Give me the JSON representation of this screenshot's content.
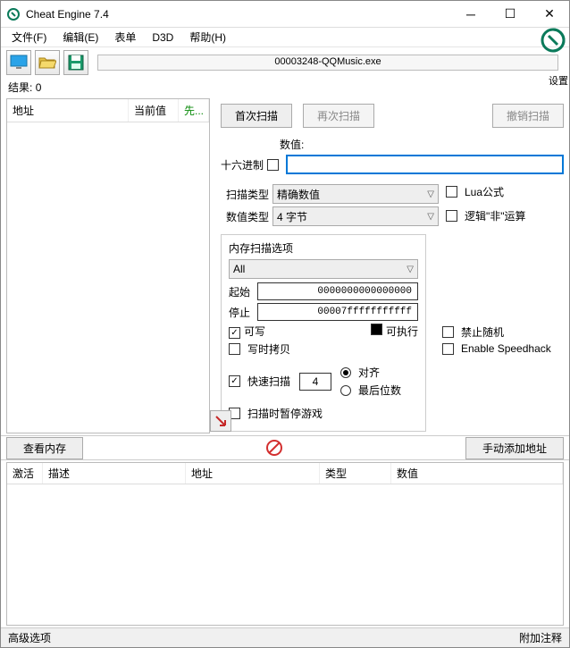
{
  "window": {
    "title": "Cheat Engine 7.4"
  },
  "menu": {
    "file": "文件(F)",
    "edit": "编辑(E)",
    "table": "表单",
    "d3d": "D3D",
    "help": "帮助(H)"
  },
  "toolbar": {
    "process_label": "00003248-QQMusic.exe",
    "settings": "设置"
  },
  "results": {
    "label": "结果:",
    "count": "0"
  },
  "left_headers": {
    "addr": "地址",
    "current": "当前值",
    "prev": "先..."
  },
  "buttons": {
    "first_scan": "首次扫描",
    "next_scan": "再次扫描",
    "undo_scan": "撤销扫描",
    "view_memory": "查看内存",
    "manual_add": "手动添加地址"
  },
  "labels": {
    "value": "数值:",
    "hex": "十六进制",
    "scan_type": "扫描类型",
    "value_type": "数值类型",
    "lua": "Lua公式",
    "not_op": "逻辑\"非\"运算",
    "mem_options": "内存扫描选项",
    "all": "All",
    "start": "起始",
    "stop": "停止",
    "writable": "可写",
    "executable": "可执行",
    "copy_on_write": "写时拷贝",
    "fast_scan": "快速扫描",
    "alignment": "对齐",
    "last_digits": "最后位数",
    "pause_while_scan": "扫描时暂停游戏",
    "no_random": "禁止随机",
    "speedhack": "Enable Speedhack"
  },
  "values": {
    "scan_type": "精确数值",
    "value_type": "4 字节",
    "value_input": "",
    "start_addr": "0000000000000000",
    "stop_addr": "00007fffffffffff",
    "fast_scan_val": "4"
  },
  "table_headers": {
    "active": "激活",
    "desc": "描述",
    "addr": "地址",
    "type": "类型",
    "value": "数值"
  },
  "status": {
    "advanced": "高级选项",
    "comments": "附加注释"
  }
}
